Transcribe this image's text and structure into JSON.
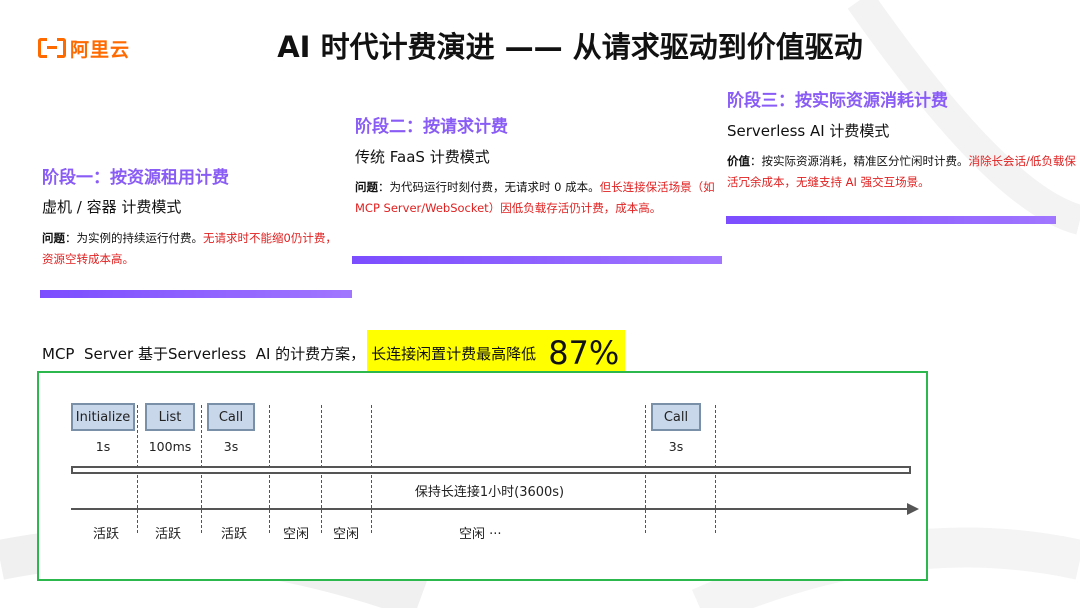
{
  "logo": {
    "text": "阿里云"
  },
  "title": "AI 时代计费演进 —— 从请求驱动到价值驱动",
  "stages": [
    {
      "title": "阶段一：按资源租用计费",
      "subtitle": "虚机 / 容器 计费模式",
      "desc_label": "问题",
      "desc_text": "：为实例的持续运行付费。",
      "desc_red": "无请求时不能缩0仍计费，资源空转成本高。"
    },
    {
      "title": "阶段二：按请求计费",
      "subtitle": "传统 FaaS 计费模式",
      "desc_label": "问题",
      "desc_text": "：为代码运行时刻付费，无请求时 0 成本。",
      "desc_red": "但长连接保活场景（如 MCP Server/WebSocket）因低负载存活仍计费，成本高。"
    },
    {
      "title": "阶段三：按实际资源消耗计费",
      "subtitle": "Serverless AI 计费模式",
      "desc_label": "价值",
      "desc_text": "：按实际资源消耗，精准区分忙闲时计费。",
      "desc_red": "消除长会话/低负载保活冗余成本，无缝支持 AI 强交互场景。"
    }
  ],
  "mcp": {
    "text": "MCP  Server 基于Serverless  AI 的计费方案，",
    "highlight": "长连接闲置计费最高降低",
    "percent": "87%"
  },
  "timeline": {
    "requests": [
      {
        "label": "Initialize",
        "duration": "1s"
      },
      {
        "label": "List",
        "duration": "100ms"
      },
      {
        "label": "Call",
        "duration": "3s"
      },
      {
        "label": "Call",
        "duration": "3s"
      }
    ],
    "connection_label": "保持长连接1小时(3600s)",
    "states": [
      "活跃",
      "活跃",
      "活跃",
      "空闲",
      "空闲",
      "空闲 ···"
    ]
  }
}
